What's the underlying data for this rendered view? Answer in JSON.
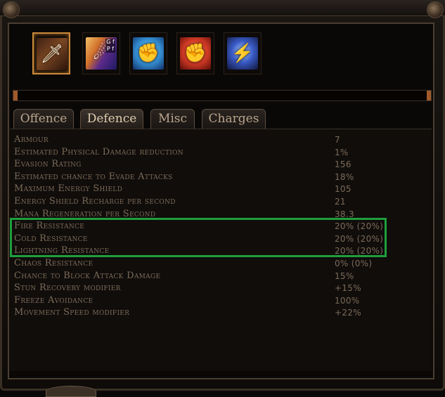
{
  "skills": [
    {
      "name": "weapon-skill",
      "glyph": "🗡"
    },
    {
      "name": "spell-skill",
      "glyph": "☄",
      "gem_letters": "G f P f"
    },
    {
      "name": "ice-fist-skill",
      "glyph": "✊"
    },
    {
      "name": "fire-fist-skill",
      "glyph": "✊"
    },
    {
      "name": "thunder-skill",
      "glyph": "⚡"
    }
  ],
  "tabs": [
    {
      "label": "Offence",
      "active": false
    },
    {
      "label": "Defence",
      "active": true
    },
    {
      "label": "Misc",
      "active": false
    },
    {
      "label": "Charges",
      "active": false
    }
  ],
  "stats": [
    {
      "label": "Armour",
      "value": "7"
    },
    {
      "label": "Estimated Physical Damage reduction",
      "value": "1%"
    },
    {
      "label": "Evasion Rating",
      "value": "156"
    },
    {
      "label": "Estimated chance to Evade Attacks",
      "value": "18%"
    },
    {
      "label": "Maximum Energy Shield",
      "value": "105"
    },
    {
      "label": "Energy Shield Recharge per second",
      "value": "21"
    },
    {
      "label": "Mana Regeneration per Second",
      "value": "38.3"
    },
    {
      "label": "Fire Resistance",
      "value": "20% (20%)"
    },
    {
      "label": "Cold Resistance",
      "value": "20% (20%)"
    },
    {
      "label": "Lightning Resistance",
      "value": "20% (20%)"
    },
    {
      "label": "Chaos Resistance",
      "value": "0% (0%)"
    },
    {
      "label": "Chance to Block Attack Damage",
      "value": "15%"
    },
    {
      "label": "Stun Recovery modifier",
      "value": "+15%"
    },
    {
      "label": "Freeze Avoidance",
      "value": "100%"
    },
    {
      "label": "Movement Speed modifier",
      "value": "+22%"
    }
  ],
  "colors": {
    "highlight": "#1e9e3c",
    "stat_text": "#7c6b58",
    "tab_active": "#e0cdb0"
  }
}
